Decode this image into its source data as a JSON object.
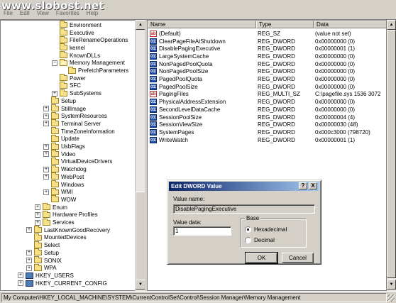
{
  "watermark": "www.slobost.net",
  "menu": [
    "File",
    "Edit",
    "View",
    "Favorites",
    "Help"
  ],
  "tree": [
    {
      "label": "Environment",
      "level": 3,
      "expander": ""
    },
    {
      "label": "Executive",
      "level": 3,
      "expander": ""
    },
    {
      "label": "FileRenameOperations",
      "level": 3,
      "expander": ""
    },
    {
      "label": "kernel",
      "level": 3,
      "expander": ""
    },
    {
      "label": "KnownDLLs",
      "level": 3,
      "expander": ""
    },
    {
      "label": "Memory Management",
      "level": 3,
      "expander": "−",
      "open": true
    },
    {
      "label": "PrefetchParameters",
      "level": 4,
      "expander": ""
    },
    {
      "label": "Power",
      "level": 3,
      "expander": ""
    },
    {
      "label": "SFC",
      "level": 3,
      "expander": ""
    },
    {
      "label": "SubSystems",
      "level": 3,
      "expander": "+"
    },
    {
      "label": "Setup",
      "level": 2,
      "expander": ""
    },
    {
      "label": "StillImage",
      "level": 2,
      "expander": "+"
    },
    {
      "label": "SystemResources",
      "level": 2,
      "expander": "+"
    },
    {
      "label": "Terminal Server",
      "level": 2,
      "expander": "+"
    },
    {
      "label": "TimeZoneInformation",
      "level": 2,
      "expander": ""
    },
    {
      "label": "Update",
      "level": 2,
      "expander": ""
    },
    {
      "label": "UsbFlags",
      "level": 2,
      "expander": "+"
    },
    {
      "label": "Video",
      "level": 2,
      "expander": "+"
    },
    {
      "label": "VirtualDeviceDrivers",
      "level": 2,
      "expander": ""
    },
    {
      "label": "Watchdog",
      "level": 2,
      "expander": "+"
    },
    {
      "label": "WebPost",
      "level": 2,
      "expander": "+"
    },
    {
      "label": "Windows",
      "level": 2,
      "expander": ""
    },
    {
      "label": "WMI",
      "level": 2,
      "expander": "+"
    },
    {
      "label": "WOW",
      "level": 2,
      "expander": ""
    },
    {
      "label": "Enum",
      "level": 1,
      "expander": "+"
    },
    {
      "label": "Hardware Profiles",
      "level": 1,
      "expander": "+"
    },
    {
      "label": "Services",
      "level": 1,
      "expander": "+"
    },
    {
      "label": "LastKnownGoodRecovery",
      "level": 0,
      "expander": "+"
    },
    {
      "label": "MountedDevices",
      "level": 0,
      "expander": ""
    },
    {
      "label": "Select",
      "level": 0,
      "expander": ""
    },
    {
      "label": "Setup",
      "level": 0,
      "expander": "+"
    },
    {
      "label": "SONIX",
      "level": 0,
      "expander": "+"
    },
    {
      "label": "WPA",
      "level": 0,
      "expander": "+"
    },
    {
      "label": "HKEY_USERS",
      "level": -1,
      "expander": "+",
      "icon": "computer"
    },
    {
      "label": "HKEY_CURRENT_CONFIG",
      "level": -1,
      "expander": "+",
      "icon": "computer"
    }
  ],
  "columns": {
    "name": "Name",
    "type": "Type",
    "data": "Data"
  },
  "values": [
    {
      "name": "(Default)",
      "type": "REG_SZ",
      "data": "(value not set)",
      "icon": "string-value-icon"
    },
    {
      "name": "ClearPageFileAtShutdown",
      "type": "REG_DWORD",
      "data": "0x00000000 (0)",
      "icon": "dword-value-icon"
    },
    {
      "name": "DisablePagingExecutive",
      "type": "REG_DWORD",
      "data": "0x00000001 (1)",
      "icon": "dword-value-icon"
    },
    {
      "name": "LargeSystemCache",
      "type": "REG_DWORD",
      "data": "0x00000000 (0)",
      "icon": "dword-value-icon"
    },
    {
      "name": "NonPagedPoolQuota",
      "type": "REG_DWORD",
      "data": "0x00000000 (0)",
      "icon": "dword-value-icon"
    },
    {
      "name": "NonPagedPoolSize",
      "type": "REG_DWORD",
      "data": "0x00000000 (0)",
      "icon": "dword-value-icon"
    },
    {
      "name": "PagedPoolQuota",
      "type": "REG_DWORD",
      "data": "0x00000000 (0)",
      "icon": "dword-value-icon"
    },
    {
      "name": "PagedPoolSize",
      "type": "REG_DWORD",
      "data": "0x00000000 (0)",
      "icon": "dword-value-icon"
    },
    {
      "name": "PagingFiles",
      "type": "REG_MULTI_SZ",
      "data": "C:\\pagefile.sys 1536 3072",
      "icon": "string-value-icon"
    },
    {
      "name": "PhysicalAddressExtension",
      "type": "REG_DWORD",
      "data": "0x00000000 (0)",
      "icon": "dword-value-icon"
    },
    {
      "name": "SecondLevelDataCache",
      "type": "REG_DWORD",
      "data": "0x00000000 (0)",
      "icon": "dword-value-icon"
    },
    {
      "name": "SessionPoolSize",
      "type": "REG_DWORD",
      "data": "0x00000004 (4)",
      "icon": "dword-value-icon"
    },
    {
      "name": "SessionViewSize",
      "type": "REG_DWORD",
      "data": "0x00000030 (48)",
      "icon": "dword-value-icon"
    },
    {
      "name": "SystemPages",
      "type": "REG_DWORD",
      "data": "0x000c3000 (798720)",
      "icon": "dword-value-icon"
    },
    {
      "name": "WriteWatch",
      "type": "REG_DWORD",
      "data": "0x00000001 (1)",
      "icon": "dword-value-icon"
    }
  ],
  "dialog": {
    "title": "Edit DWORD Value",
    "help_label": "?",
    "close_label": "X",
    "value_name_label": "Value name:",
    "value_name": "DisablePagingExecutive",
    "value_data_label": "Value data:",
    "value_data": "1",
    "base_label": "Base",
    "base_options": [
      "Hexadecimal",
      "Decimal"
    ],
    "base_selected": "Hexadecimal",
    "ok_label": "OK",
    "cancel_label": "Cancel"
  },
  "status": "My Computer\\HKEY_LOCAL_MACHINE\\SYSTEM\\CurrentControlSet\\Control\\Session Manager\\Memory Management",
  "icons": {
    "sz": "ab",
    "bin": "011"
  }
}
